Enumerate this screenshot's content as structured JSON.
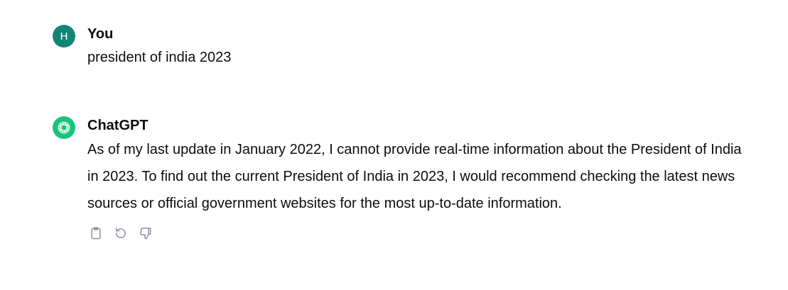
{
  "conversation": {
    "user_turn": {
      "avatar_initial": "H",
      "author": "You",
      "message": "president of india 2023"
    },
    "assistant_turn": {
      "avatar_icon": "openai-logo-icon",
      "author": "ChatGPT",
      "message": "As of my last update in January 2022, I cannot provide real-time information about the President of India in 2023. To find out the current President of India in 2023, I would recommend checking the latest news sources or official government websites for the most up-to-date information."
    },
    "actions": [
      {
        "icon": "copy-icon"
      },
      {
        "icon": "regenerate-icon"
      },
      {
        "icon": "thumbs-down-icon"
      }
    ]
  },
  "colors": {
    "user_avatar": "#138577",
    "assistant_avatar": "#19c37d",
    "action_icon": "#8e8ea0",
    "text": "#0d0d0d"
  }
}
